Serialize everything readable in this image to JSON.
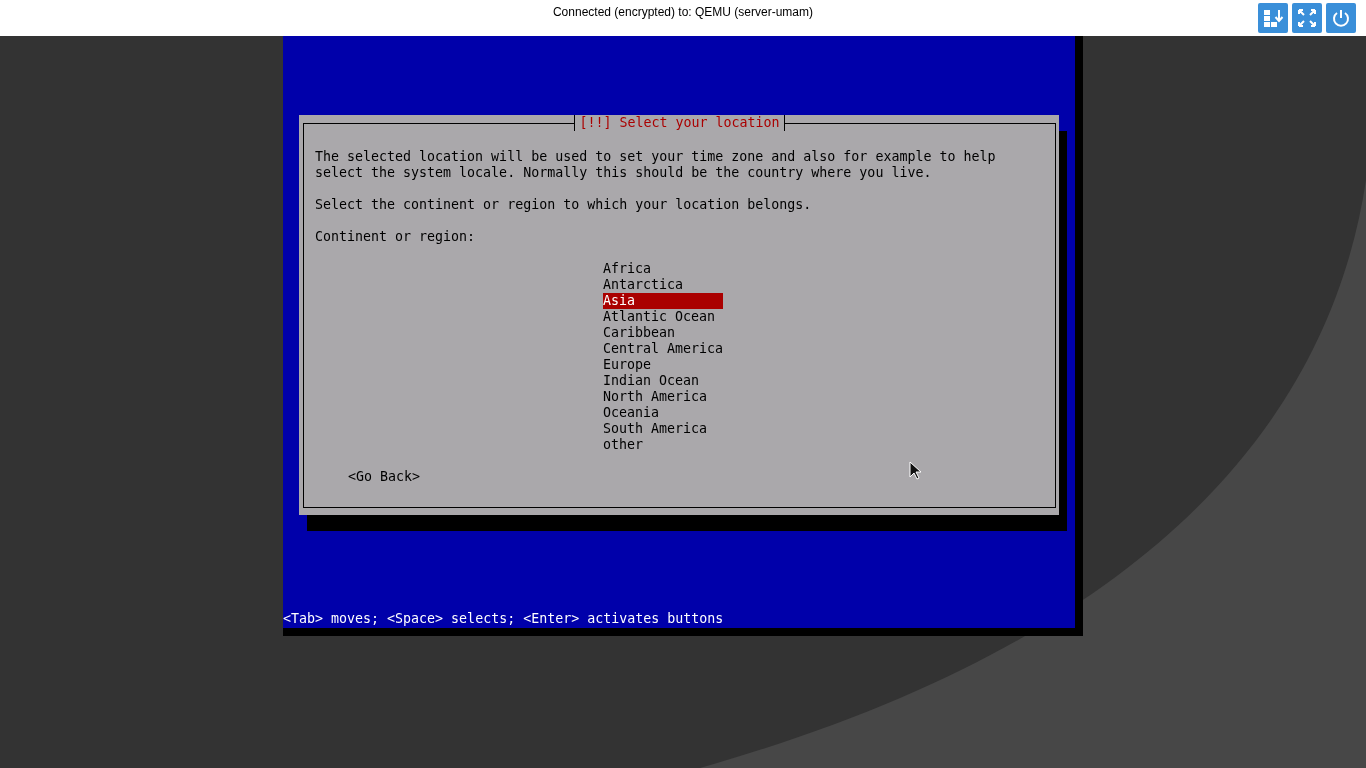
{
  "top_bar": {
    "title": "Connected (encrypted) to: QEMU (server-umam)"
  },
  "dialog": {
    "title": "[!!] Select your location",
    "paragraphs": [
      "The selected location will be used to set your time zone and also for example to help\nselect the system locale. Normally this should be the country where you live.",
      "Select the continent or region to which your location belongs."
    ],
    "prompt": "Continent or region:",
    "options": [
      {
        "label": "Africa",
        "selected": false
      },
      {
        "label": "Antarctica",
        "selected": false
      },
      {
        "label": "Asia",
        "selected": true
      },
      {
        "label": "Atlantic Ocean",
        "selected": false
      },
      {
        "label": "Caribbean",
        "selected": false
      },
      {
        "label": "Central America",
        "selected": false
      },
      {
        "label": "Europe",
        "selected": false
      },
      {
        "label": "Indian Ocean",
        "selected": false
      },
      {
        "label": "North America",
        "selected": false
      },
      {
        "label": "Oceania",
        "selected": false
      },
      {
        "label": "South America",
        "selected": false
      },
      {
        "label": "other",
        "selected": false
      }
    ],
    "back_button": "<Go Back>"
  },
  "help_line": "<Tab> moves; <Space> selects; <Enter> activates buttons"
}
